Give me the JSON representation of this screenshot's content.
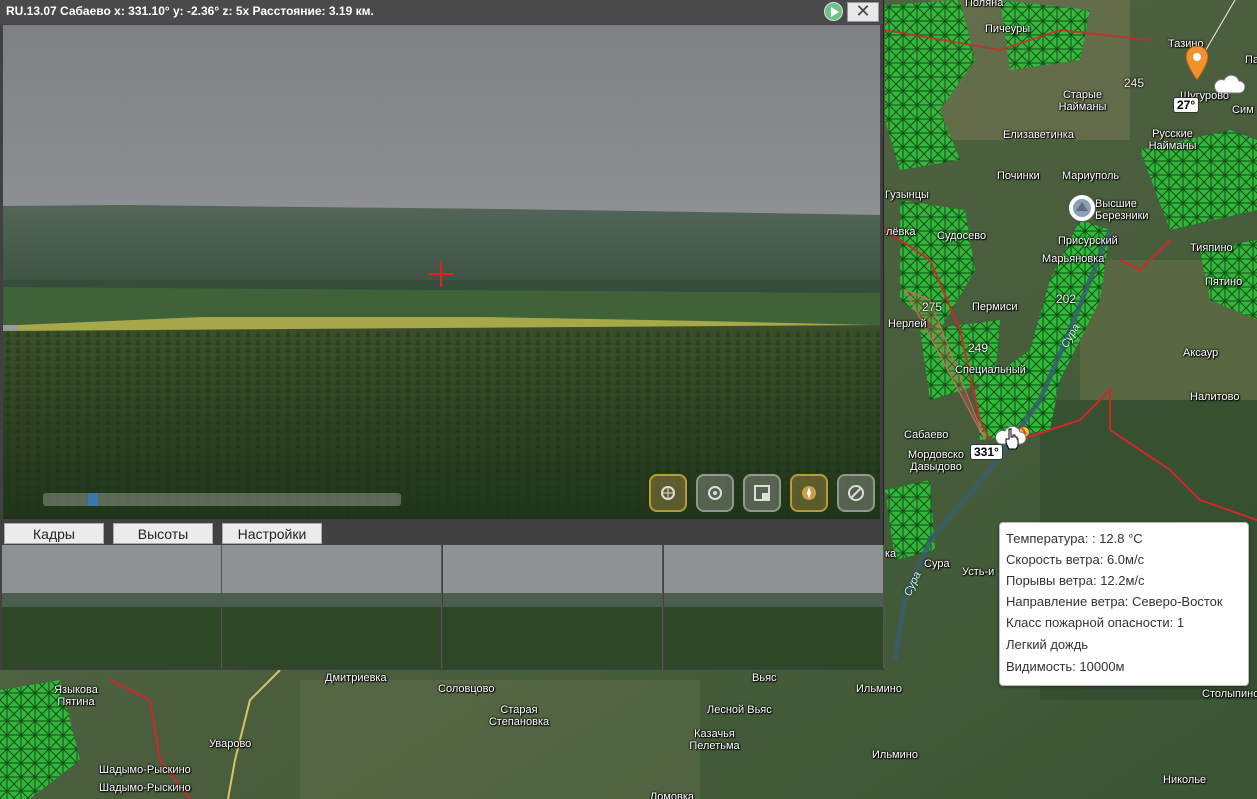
{
  "camera_window": {
    "title": "RU.13.07 Сабаево x: 331.10° y: -2.36° z: 5x Расстояние: 3.19 км.",
    "close_label": "✕",
    "tabs": [
      "Кадры",
      "Высоты",
      "Настройки"
    ],
    "controls": [
      "panorama-icon",
      "rotate-icon",
      "frame-icon",
      "compass-icon",
      "layers-icon"
    ],
    "scrubber_position": 0.13
  },
  "map": {
    "places": [
      "Полянa",
      "Пичеуры",
      "Тазино",
      "Старые Наймaны",
      "Елизаветинка",
      "Русские Наймaны",
      "Починки",
      "Мариуполь",
      "Гузынцы",
      "Судосево",
      "Присурский",
      "Высшие Березники",
      "Марьяновка",
      "Тияпино",
      "Пятино",
      "Пермиси",
      "Нерлей",
      "Специальный",
      "Аксаур",
      "Налитово",
      "Сабаево",
      "Мордовско Давыдово",
      "Сура",
      "Усть-и",
      "Языкова Пятина",
      "Дмитриевка",
      "Соловцово",
      "Вьяс",
      "Ильмино",
      "Старая Степановка",
      "Лесной Вьяс",
      "Уварово",
      "Казачья Пелетьма",
      "Столыпино",
      "Ильмино",
      "Шадымо-Рыскино",
      "Шадымо-Рыскино",
      "Николье",
      "Ломовка",
      "Сим",
      "Па",
      "ка",
      "лёвка",
      "Шугурово"
    ],
    "numbers": [
      "245",
      "202",
      "275",
      "249"
    ],
    "rivers": [
      "Сура",
      "Сура"
    ],
    "camera_badge": "331°",
    "temperature_badge": "27°"
  },
  "weather_popup": {
    "temperature": "Температура: : 12.8 °C",
    "wind_speed": "Скорость ветра: 6.0м/с",
    "wind_gusts": "Порывы ветра: 12.2м/с",
    "wind_direction": "Направление ветра: Северо-Восток",
    "fire_class": "Класс пожарной опасности: 1",
    "condition": "Легкий дождь",
    "visibility": "Видимость: 10000м"
  }
}
